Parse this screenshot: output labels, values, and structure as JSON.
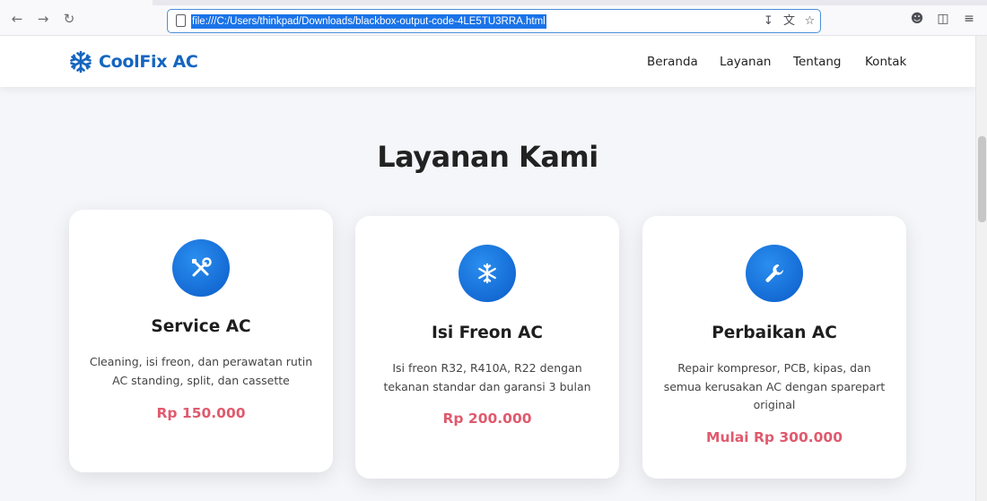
{
  "browser": {
    "url": "file:///C:/Users/thinkpad/Downloads/blackbox-output-code-4LE5TU3RRA.html"
  },
  "site": {
    "brand": "CoolFix AC",
    "menu": [
      "Beranda",
      "Layanan",
      "Tentang",
      "Kontak"
    ]
  },
  "section": {
    "title": "Layanan Kami",
    "cards": [
      {
        "icon": "tools-icon",
        "title": "Service AC",
        "description": "Cleaning, isi freon, dan perawatan rutin AC standing, split, dan cassette",
        "price": "Rp 150.000"
      },
      {
        "icon": "snowflake-icon",
        "title": "Isi Freon AC",
        "description": "Isi freon R32, R410A, R22 dengan tekanan standar dan garansi 3 bulan",
        "price": "Rp 200.000"
      },
      {
        "icon": "wrench-icon",
        "title": "Perbaikan AC",
        "description": "Repair kompresor, PCB, kipas, dan semua kerusakan AC dengan sparepart original",
        "price": "Mulai Rp 300.000"
      }
    ]
  },
  "colors": {
    "brand": "#1565c0",
    "price": "#e05a6e",
    "icon_bg": "#0b5cc8"
  }
}
